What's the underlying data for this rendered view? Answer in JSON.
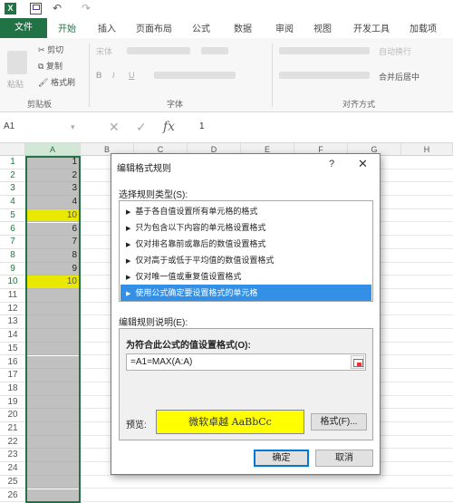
{
  "tabs": [
    "文件",
    "开始",
    "插入",
    "页面布局",
    "公式",
    "数据",
    "审阅",
    "视图",
    "开发工具",
    "加载项"
  ],
  "ribbon": {
    "cut": "剪切",
    "copy": "复制",
    "format_painter": "格式刷",
    "paste": "粘贴",
    "clipboard_group": "剪贴板",
    "font_group": "字体",
    "align_group": "对齐方式",
    "font_name": "宋体",
    "wrap_text": "自动换行",
    "merge_center": "合并后居中"
  },
  "formula_bar": {
    "name_box": "A1",
    "fx": "fx",
    "value": "1"
  },
  "columns": [
    "A",
    "B",
    "C",
    "D",
    "E",
    "F",
    "G",
    "H"
  ],
  "rows": [
    {
      "n": "1",
      "a": "1",
      "hl": false
    },
    {
      "n": "2",
      "a": "2",
      "hl": false
    },
    {
      "n": "3",
      "a": "3",
      "hl": false
    },
    {
      "n": "4",
      "a": "4",
      "hl": false
    },
    {
      "n": "5",
      "a": "10",
      "hl": true
    },
    {
      "n": "6",
      "a": "6",
      "hl": false
    },
    {
      "n": "7",
      "a": "7",
      "hl": false
    },
    {
      "n": "8",
      "a": "8",
      "hl": false
    },
    {
      "n": "9",
      "a": "9",
      "hl": false
    },
    {
      "n": "10",
      "a": "10",
      "hl": true
    },
    {
      "n": "11",
      "a": "",
      "hl": false
    },
    {
      "n": "12",
      "a": "",
      "hl": false
    },
    {
      "n": "13",
      "a": "",
      "hl": false
    },
    {
      "n": "14",
      "a": "",
      "hl": false
    },
    {
      "n": "15",
      "a": "",
      "hl": false
    },
    {
      "n": "16",
      "a": "",
      "hl": false
    },
    {
      "n": "17",
      "a": "",
      "hl": false
    },
    {
      "n": "18",
      "a": "",
      "hl": false
    },
    {
      "n": "19",
      "a": "",
      "hl": false
    },
    {
      "n": "20",
      "a": "",
      "hl": false
    },
    {
      "n": "21",
      "a": "",
      "hl": false
    },
    {
      "n": "22",
      "a": "",
      "hl": false
    },
    {
      "n": "23",
      "a": "",
      "hl": false
    },
    {
      "n": "24",
      "a": "",
      "hl": false
    },
    {
      "n": "25",
      "a": "",
      "hl": false
    },
    {
      "n": "26",
      "a": "",
      "hl": false
    }
  ],
  "dialog": {
    "title": "编辑格式规则",
    "help": "?",
    "close": "✕",
    "rule_type_label": "选择规则类型(S):",
    "rule_types": [
      "基于各自值设置所有单元格的格式",
      "只为包含以下内容的单元格设置格式",
      "仅对排名靠前或靠后的数值设置格式",
      "仅对高于或低于平均值的数值设置格式",
      "仅对唯一值或重复值设置格式",
      "使用公式确定要设置格式的单元格"
    ],
    "selected_rule_index": 5,
    "desc_label": "编辑规则说明(E):",
    "formula_label": "为符合此公式的值设置格式(O):",
    "formula": "=A1=MAX(A:A)",
    "preview_label": "预览:",
    "preview_text": "微软卓越  AaBbCc",
    "preview_bg": "#ffff00",
    "format_button": "格式(F)...",
    "ok": "确定",
    "cancel": "取消"
  },
  "colors": {
    "excel_green": "#217346",
    "selection_fill": "#c0c0c0",
    "highlight": "#e8e800",
    "selected_item": "#3390e6"
  }
}
